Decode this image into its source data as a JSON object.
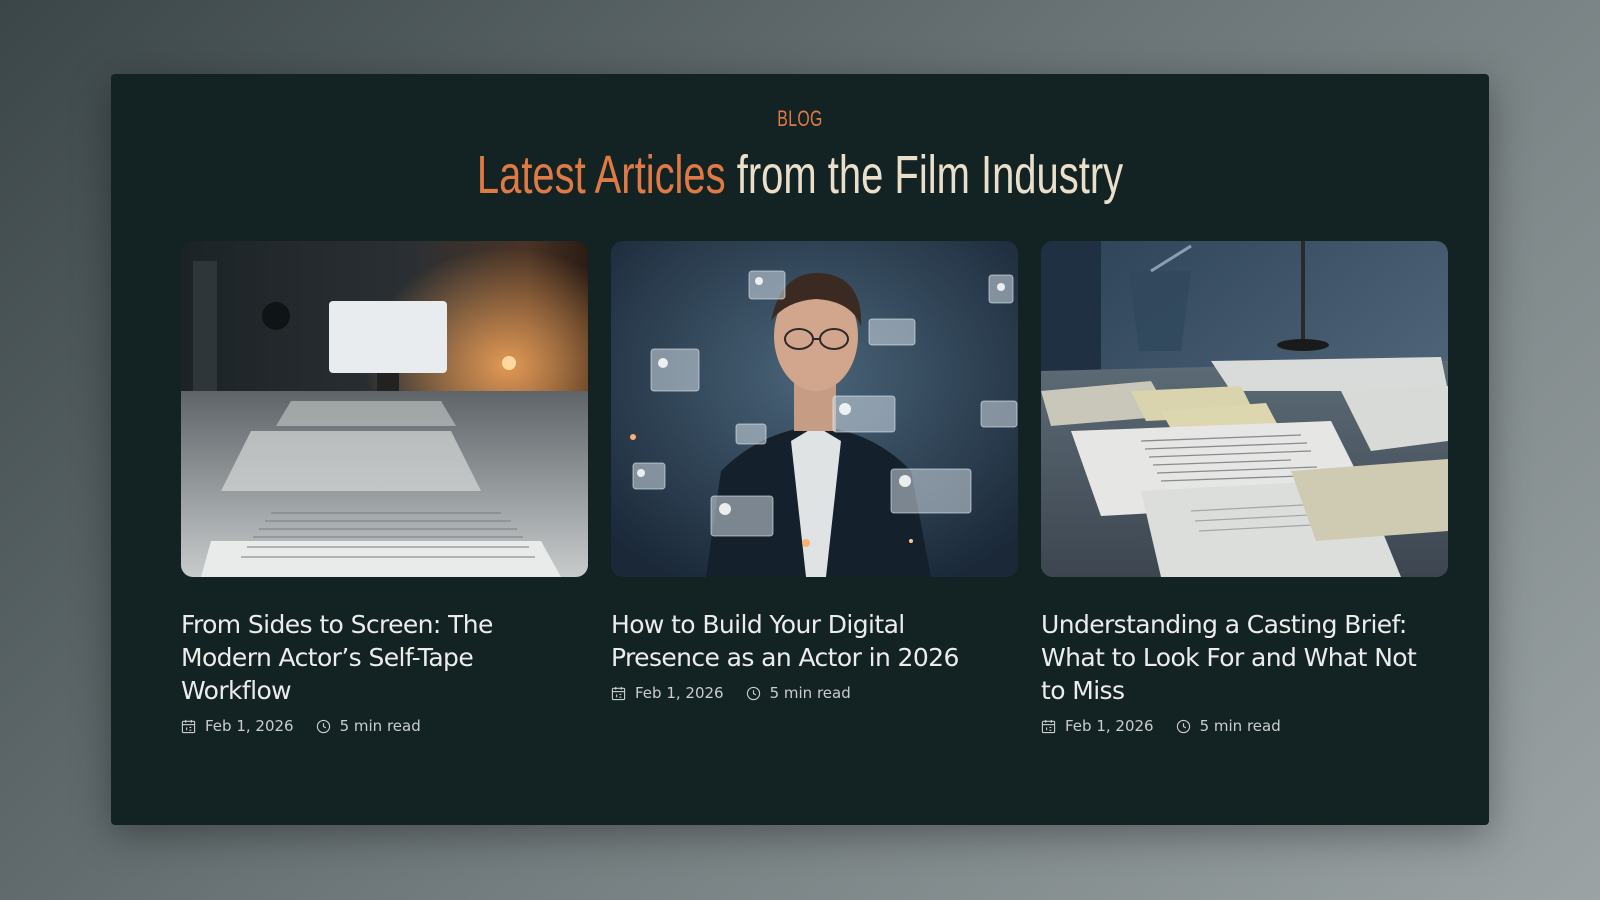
{
  "section": {
    "eyebrow": "BLOG",
    "heading_accent": "Latest Articles",
    "heading_rest": " from the Film Industry"
  },
  "colors": {
    "accent": "#e07a45",
    "panel": "#132223",
    "heading": "#eadfcb"
  },
  "articles": [
    {
      "title": "From Sides to Screen: The Modern Actor’s Self-Tape Workflow",
      "date": "Feb 1, 2026",
      "read_time": "5 min read",
      "image": "desk-with-script-and-monitor"
    },
    {
      "title": "How to Build Your Digital Presence as an Actor in 2026",
      "date": "Feb 1, 2026",
      "read_time": "5 min read",
      "image": "man-with-floating-profile-cards"
    },
    {
      "title": "Understanding a Casting Brief: What to Look For and What Not to Miss",
      "date": "Feb 1, 2026",
      "read_time": "5 min read",
      "image": "papers-and-sticky-notes-on-desk"
    }
  ],
  "icons": {
    "date": "calendar-icon",
    "time": "clock-icon"
  }
}
